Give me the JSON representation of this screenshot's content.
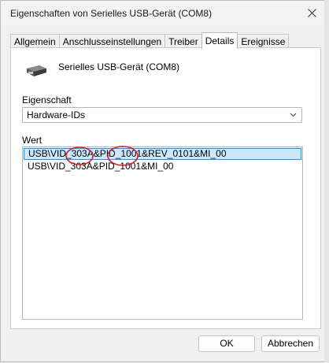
{
  "window": {
    "title": "Eigenschaften von Serielles USB-Gerät (COM8)",
    "close_icon": "close-icon"
  },
  "tabs": [
    {
      "label": "Allgemein",
      "active": false
    },
    {
      "label": "Anschlusseinstellungen",
      "active": false
    },
    {
      "label": "Treiber",
      "active": false
    },
    {
      "label": "Details",
      "active": true
    },
    {
      "label": "Ereignisse",
      "active": false
    }
  ],
  "device": {
    "icon": "usb-serial-device-icon",
    "name": "Serielles USB-Gerät (COM8)"
  },
  "property": {
    "label": "Eigenschaft",
    "selected": "Hardware-IDs"
  },
  "value": {
    "label": "Wert",
    "items": [
      "USB\\VID_303A&PID_1001&REV_0101&MI_00",
      "USB\\VID_303A&PID_1001&MI_00"
    ],
    "selected_index": 0,
    "annotation_color": "#d3212c"
  },
  "buttons": {
    "ok": "OK",
    "cancel": "Abbrechen"
  }
}
